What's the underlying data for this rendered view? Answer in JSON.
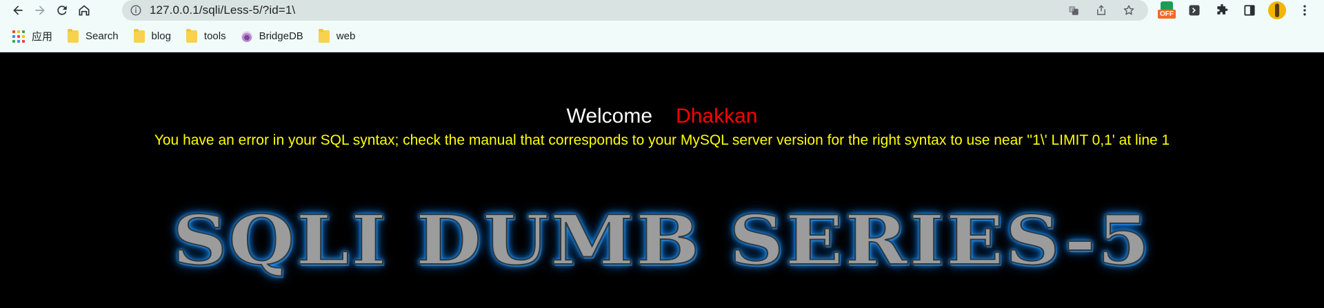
{
  "browser": {
    "url": "127.0.0.1/sqli/Less-5/?id=1\\",
    "nav": {
      "back": "back-arrow-icon",
      "forward": "forward-arrow-icon",
      "reload": "reload-icon",
      "home": "home-icon"
    },
    "omnibox_icons": [
      "translate-icon",
      "share-icon",
      "star-icon"
    ],
    "extension_off_label": "OFF"
  },
  "bookmarks": [
    {
      "label": "应用",
      "icon": "apps-grid-icon"
    },
    {
      "label": "Search",
      "icon": "folder-icon"
    },
    {
      "label": "blog",
      "icon": "folder-icon"
    },
    {
      "label": "tools",
      "icon": "folder-icon"
    },
    {
      "label": "BridgeDB",
      "icon": "onion-icon"
    },
    {
      "label": "web",
      "icon": "folder-icon"
    }
  ],
  "page": {
    "welcome": "Welcome",
    "username": "Dhakkan",
    "error_message": "You have an error in your SQL syntax; check the manual that corresponds to your MySQL server version for the right syntax to use near ''1\\' LIMIT 0,1' at line 1",
    "banner_text": "SQLI DUMB SERIES-5"
  },
  "colors": {
    "welcome": "#ffffff",
    "username": "#ff0000",
    "error": "#ffff00",
    "background": "#000000",
    "banner_glow": "#1e90ff"
  }
}
